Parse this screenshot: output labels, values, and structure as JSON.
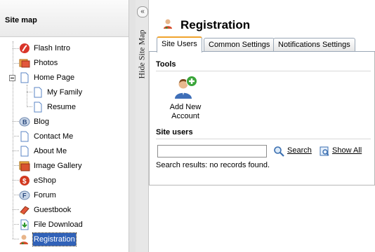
{
  "sitemap": {
    "title": "Site map",
    "items": [
      {
        "label": "Flash Intro",
        "icon": "flash-icon"
      },
      {
        "label": "Photos",
        "icon": "photos-icon"
      },
      {
        "label": "Home Page",
        "icon": "page-icon"
      },
      {
        "label": "My Family",
        "icon": "page-icon"
      },
      {
        "label": "Resume",
        "icon": "page-icon"
      },
      {
        "label": "Blog",
        "icon": "blog-icon"
      },
      {
        "label": "Contact Me",
        "icon": "page-icon"
      },
      {
        "label": "About Me",
        "icon": "page-icon"
      },
      {
        "label": "Image Gallery",
        "icon": "gallery-icon"
      },
      {
        "label": "eShop",
        "icon": "eshop-icon"
      },
      {
        "label": "Forum",
        "icon": "forum-icon"
      },
      {
        "label": "Guestbook",
        "icon": "guestbook-icon"
      },
      {
        "label": "File Download",
        "icon": "download-icon"
      },
      {
        "label": "Registration",
        "icon": "registration-icon",
        "selected": true
      }
    ]
  },
  "splitter": {
    "collapse_glyph": "«",
    "hide_label": "Hide Site Map"
  },
  "page": {
    "title": "Registration",
    "tabs": [
      {
        "label": "Site Users",
        "active": true
      },
      {
        "label": "Common Settings",
        "active": false
      },
      {
        "label": "Notifications Settings",
        "active": false
      }
    ],
    "tools_heading": "Tools",
    "add_account": {
      "line1": "Add New",
      "line2": "Account"
    },
    "site_users_heading": "Site users",
    "search": {
      "value": "",
      "button": "Search",
      "show_all": "Show All"
    },
    "results_text": "Search results: no records found."
  },
  "colors": {
    "selection": "#3162b8",
    "active_tab_accent": "#f0a32d",
    "tab_border": "#9aa7b6"
  }
}
